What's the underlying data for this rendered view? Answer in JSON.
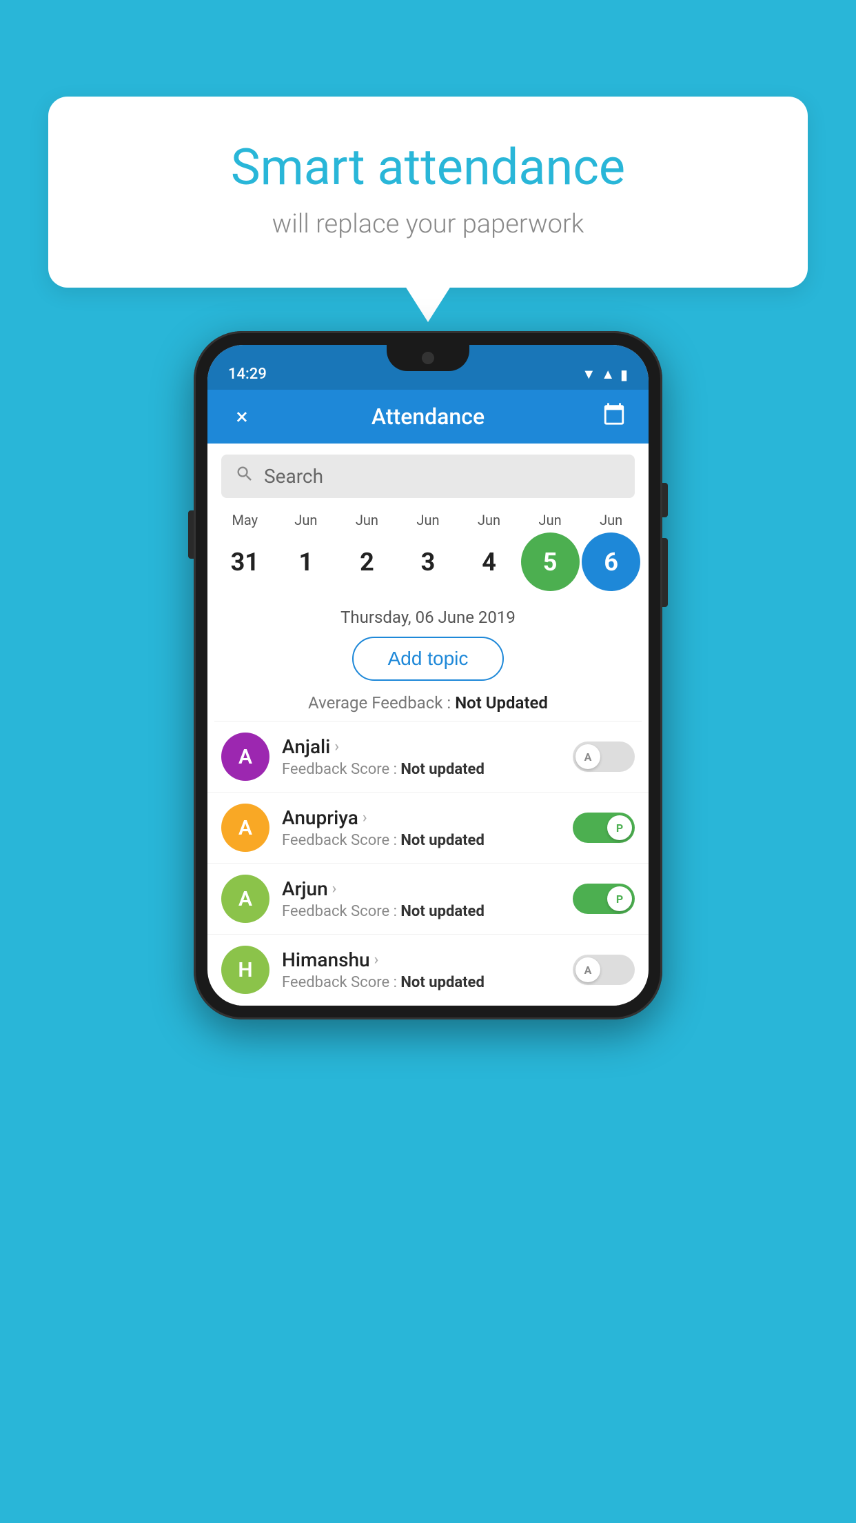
{
  "background_color": "#29b6d8",
  "bubble": {
    "title": "Smart attendance",
    "subtitle": "will replace your paperwork"
  },
  "status_bar": {
    "time": "14:29",
    "icons": [
      "wifi",
      "signal",
      "battery"
    ]
  },
  "app_bar": {
    "title": "Attendance",
    "close_label": "×",
    "calendar_label": "📅"
  },
  "search": {
    "placeholder": "Search"
  },
  "calendar": {
    "months": [
      "May",
      "Jun",
      "Jun",
      "Jun",
      "Jun",
      "Jun",
      "Jun"
    ],
    "dates": [
      "31",
      "1",
      "2",
      "3",
      "4",
      "5",
      "6"
    ],
    "selected_green_index": 5,
    "selected_blue_index": 6
  },
  "selected_date": "Thursday, 06 June 2019",
  "add_topic_label": "Add topic",
  "avg_feedback_label": "Average Feedback :",
  "avg_feedback_value": "Not Updated",
  "students": [
    {
      "name": "Anjali",
      "avatar_letter": "A",
      "avatar_color": "#9c27b0",
      "feedback_label": "Feedback Score :",
      "feedback_value": "Not updated",
      "toggle_state": "off",
      "toggle_label": "A"
    },
    {
      "name": "Anupriya",
      "avatar_letter": "A",
      "avatar_color": "#f9a825",
      "feedback_label": "Feedback Score :",
      "feedback_value": "Not updated",
      "toggle_state": "on",
      "toggle_label": "P"
    },
    {
      "name": "Arjun",
      "avatar_letter": "A",
      "avatar_color": "#8bc34a",
      "feedback_label": "Feedback Score :",
      "feedback_value": "Not updated",
      "toggle_state": "on",
      "toggle_label": "P"
    },
    {
      "name": "Himanshu",
      "avatar_letter": "H",
      "avatar_color": "#8bc34a",
      "feedback_label": "Feedback Score :",
      "feedback_value": "Not updated",
      "toggle_state": "off",
      "toggle_label": "A"
    }
  ]
}
